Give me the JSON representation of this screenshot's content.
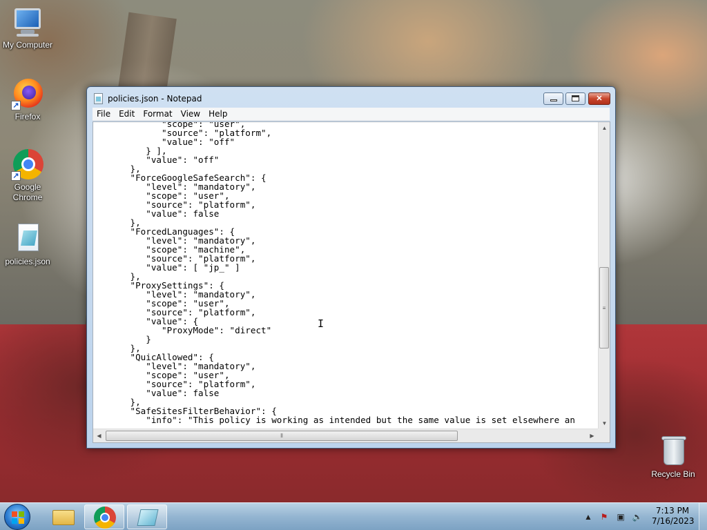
{
  "desktop": {
    "icons": [
      {
        "label": "My Computer"
      },
      {
        "label": "Firefox"
      },
      {
        "label": "Google Chrome"
      },
      {
        "label": "policies.json"
      },
      {
        "label": "Recycle Bin"
      }
    ]
  },
  "window": {
    "title": "policies.json - Notepad",
    "controls": {
      "minimize": "–",
      "maximize": "□",
      "close": "✕"
    },
    "menu": [
      "File",
      "Edit",
      "Format",
      "View",
      "Help"
    ],
    "content_lines": [
      "            \"scope\": \"user\",",
      "            \"source\": \"platform\",",
      "            \"value\": \"off\"",
      "         } ],",
      "         \"value\": \"off\"",
      "      },",
      "      \"ForceGoogleSafeSearch\": {",
      "         \"level\": \"mandatory\",",
      "         \"scope\": \"user\",",
      "         \"source\": \"platform\",",
      "         \"value\": false",
      "      },",
      "      \"ForcedLanguages\": {",
      "         \"level\": \"mandatory\",",
      "         \"scope\": \"machine\",",
      "         \"source\": \"platform\",",
      "         \"value\": [ \"jp_\" ]",
      "      },",
      "      \"ProxySettings\": {",
      "         \"level\": \"mandatory\",",
      "         \"scope\": \"user\",",
      "         \"source\": \"platform\",",
      "         \"value\": {",
      "            \"ProxyMode\": \"direct\"",
      "         }",
      "      },",
      "      \"QuicAllowed\": {",
      "         \"level\": \"mandatory\",",
      "         \"scope\": \"user\",",
      "         \"source\": \"platform\",",
      "         \"value\": false",
      "      },",
      "      \"SafeSitesFilterBehavior\": {",
      "         \"info\": \"This policy is working as intended but the same value is set elsewhere an"
    ]
  },
  "taskbar": {
    "apps": [
      {
        "name": "Windows Explorer",
        "icon": "folder-icon",
        "active": false
      },
      {
        "name": "Google Chrome",
        "icon": "chrome-icon",
        "active": false
      },
      {
        "name": "Notepad",
        "icon": "notepad-icon",
        "active": true
      }
    ],
    "tray": {
      "time": "7:13 PM",
      "date": "7/16/2023"
    }
  },
  "colors": {
    "taskbar": "#9dbcd9",
    "close_button": "#c8452c",
    "wallpaper_red": "#a33034"
  }
}
